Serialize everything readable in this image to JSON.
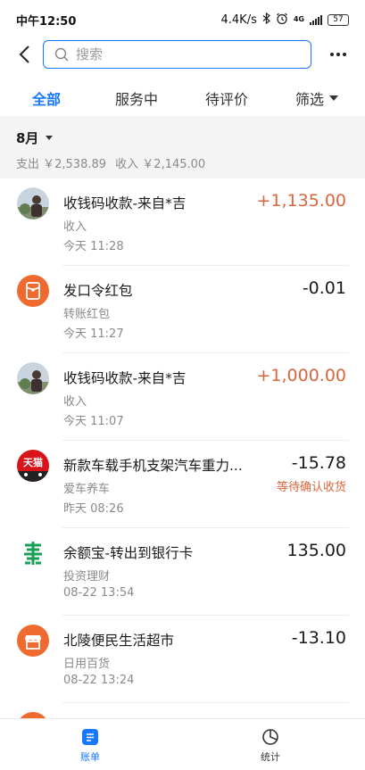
{
  "status_bar": {
    "time": "中午12:50",
    "speed": "4.4K/s",
    "network": "4G",
    "battery": "57"
  },
  "search": {
    "placeholder": "搜索"
  },
  "tabs": [
    {
      "label": "全部",
      "active": true
    },
    {
      "label": "服务中",
      "active": false
    },
    {
      "label": "待评价",
      "active": false
    },
    {
      "label": "筛选",
      "active": false
    }
  ],
  "month": {
    "label": "8月",
    "expense": "支出 ￥2,538.89",
    "income": "收入 ￥2,145.00"
  },
  "transactions": [
    {
      "title": "收钱码收款-来自*吉",
      "category": "收入",
      "time": "今天  11:28",
      "amount": "+1,135.00",
      "type": "income",
      "icon": "user-avatar-icon",
      "status": ""
    },
    {
      "title": "发口令红包",
      "category": "转账红包",
      "time": "今天  11:27",
      "amount": "-0.01",
      "type": "expense",
      "icon": "red-packet-icon",
      "status": ""
    },
    {
      "title": "收钱码收款-来自*吉",
      "category": "收入",
      "time": "今天  11:07",
      "amount": "+1,000.00",
      "type": "income",
      "icon": "user-avatar-icon",
      "status": ""
    },
    {
      "title": "新款车载手机支架汽车重力...",
      "category": "爱车养车",
      "time": "昨天  08:26",
      "amount": "-15.78",
      "type": "expense",
      "icon": "tmall-icon",
      "status": "等待确认收货"
    },
    {
      "title": "余额宝-转出到银行卡",
      "category": "投资理财",
      "time": "08-22  13:54",
      "amount": "135.00",
      "type": "neutral",
      "icon": "bank-card-icon",
      "status": ""
    },
    {
      "title": "北陵便民生活超市",
      "category": "日用百货",
      "time": "08-22  13:24",
      "amount": "-13.10",
      "type": "expense",
      "icon": "store-icon",
      "status": ""
    }
  ],
  "bottom_nav": {
    "bill_label": "账单",
    "stats_label": "统计"
  },
  "colors": {
    "accent": "#1677ff",
    "income": "#d8663c",
    "orange_icon": "#ee6a2f",
    "tmall_red": "#d8141a",
    "green_icon": "#18a058"
  }
}
